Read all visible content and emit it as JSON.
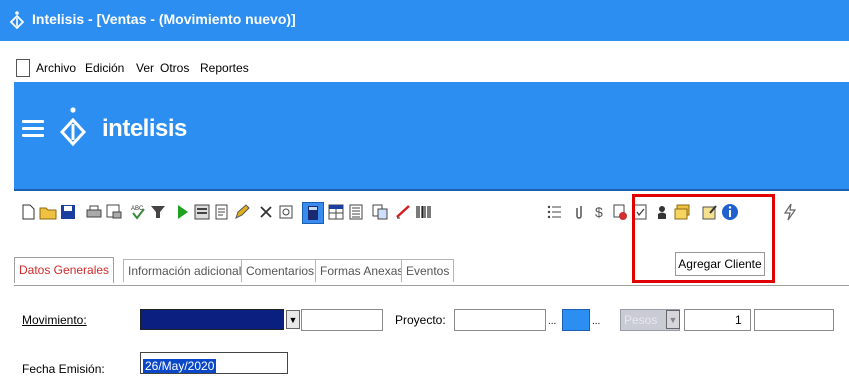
{
  "window": {
    "title": "Intelisis - [Ventas - (Movimiento nuevo)]"
  },
  "menu": {
    "items": [
      "Archivo",
      "Edición",
      "Ver",
      "Otros",
      "Reportes"
    ]
  },
  "banner": {
    "brand": "intelisis"
  },
  "toolbar": {
    "icons": [
      "new-icon",
      "open-folder-icon",
      "save-icon",
      "print-icon",
      "print-preview-icon",
      "spell-check-icon",
      "filter-icon",
      "play-icon",
      "form-icon",
      "report-icon",
      "edit-icon",
      "delete-icon",
      "attachment-view-icon",
      "calculator-icon",
      "grid-icon",
      "list-icon",
      "copy-icon",
      "signature-icon",
      "barcode-icon",
      "bullet-list-icon",
      "paperclip-icon",
      "dollar-icon",
      "document-stamp-icon",
      "checklist-icon",
      "add-client-icon",
      "folders-icon",
      "notes-icon",
      "info-icon",
      "lightning-icon"
    ],
    "tooltip": "Agregar Cliente",
    "highlight_color": "#e00000"
  },
  "tabs": [
    "Datos Generales",
    "Información adicional",
    "Comentarios",
    "Formas Anexas",
    "Eventos"
  ],
  "form": {
    "movimiento_label": "Movimiento:",
    "proyecto_label": "Proyecto:",
    "ellipsis": "...",
    "moneda_value": "Pesos",
    "tipo_cambio_value": "1",
    "fecha_label": "Fecha Emisión:",
    "fecha_value": "26/May/2020"
  },
  "colors": {
    "accent": "#2b8ef0",
    "active_tab": "#d22a2a",
    "selected_field": "#0a1f80"
  }
}
